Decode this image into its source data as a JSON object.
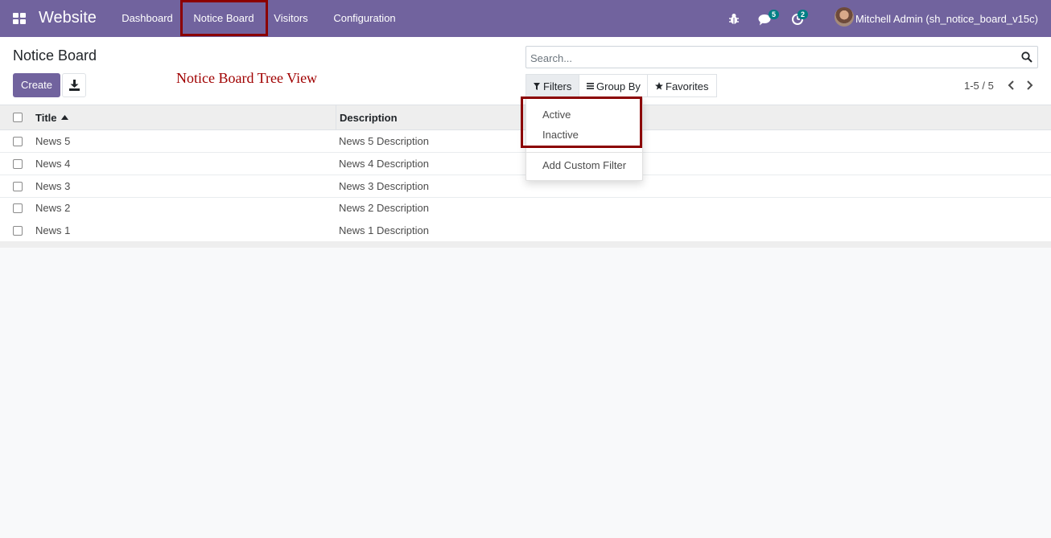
{
  "navbar": {
    "brand": "Website",
    "menu": [
      "Dashboard",
      "Notice Board",
      "Visitors",
      "Configuration"
    ],
    "messages_count": "5",
    "activities_count": "2",
    "user": "Mitchell Admin (sh_notice_board_v15c)",
    "icons": [
      "apps-icon",
      "bug-icon",
      "chat-icon",
      "clock-icon"
    ]
  },
  "breadcrumb": {
    "title": "Notice Board"
  },
  "annotation": "Notice Board Tree View",
  "toolbar": {
    "create_label": "Create"
  },
  "search": {
    "placeholder": "Search..."
  },
  "filters": {
    "filters_label": "Filters",
    "group_by_label": "Group By",
    "favorites_label": "Favorites"
  },
  "pager": {
    "value": "1-5 / 5"
  },
  "table": {
    "headers": [
      "Title",
      "Description"
    ],
    "rows": [
      [
        "News 5",
        "News 5 Description"
      ],
      [
        "News 4",
        "News 4 Description"
      ],
      [
        "News 3",
        "News 3 Description"
      ],
      [
        "News 2",
        "News 2 Description"
      ],
      [
        "News 1",
        "News 1 Description"
      ]
    ]
  },
  "filter_dropdown": {
    "items": [
      "Active",
      "Inactive"
    ],
    "custom": "Add Custom Filter"
  },
  "colors": {
    "navbar": "#71639e",
    "highlight": "#8b0000",
    "annotation": "#a00000"
  }
}
